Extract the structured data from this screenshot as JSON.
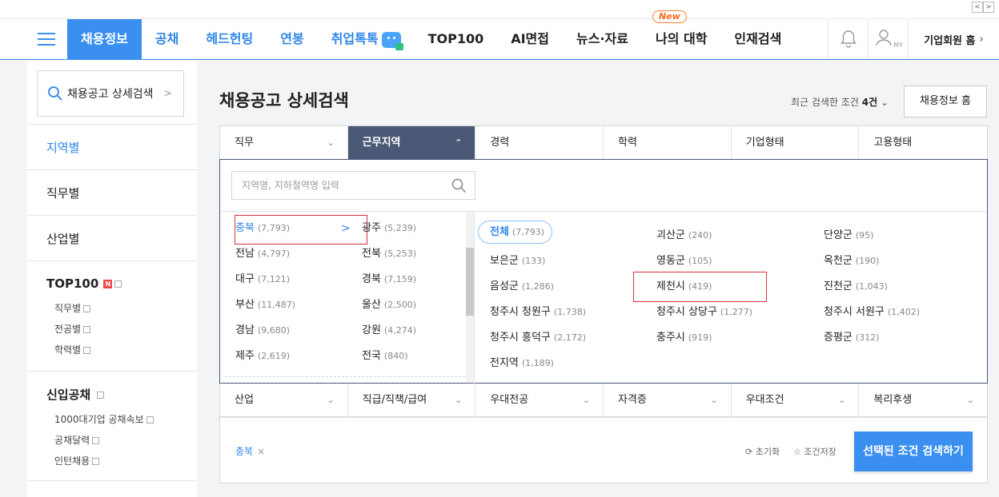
{
  "pager": {
    "prev": "<",
    "next": ">"
  },
  "nav": {
    "items": [
      {
        "label": "채용정보"
      },
      {
        "label": "공채"
      },
      {
        "label": "헤드헌팅"
      },
      {
        "label": "연봉"
      },
      {
        "label": "취업톡톡"
      },
      {
        "label": "TOP100"
      },
      {
        "label": "AI면접"
      },
      {
        "label": "뉴스·자료"
      },
      {
        "label": "나의 대학",
        "badge": "New"
      },
      {
        "label": "인재검색"
      }
    ],
    "my_label": "MY",
    "corp_label": "기업회원 홈",
    "corp_chevron": "›"
  },
  "sidebar": {
    "search_label": "채용공고 상세검색",
    "chevron": ">",
    "sections": [
      {
        "title": "지역별"
      },
      {
        "title": "직무별"
      },
      {
        "title": "산업별"
      },
      {
        "title": "TOP100",
        "badge": "N",
        "items": [
          "직무별",
          "전공별",
          "학력별"
        ]
      },
      {
        "title": "신입공채",
        "items": [
          "1000대기업 공채속보",
          "공채달력",
          "인턴채용"
        ]
      }
    ]
  },
  "main": {
    "title": "채용공고 상세검색",
    "recent_prefix": "최근 검색한 조건",
    "recent_count": "4건",
    "recent_chevron": "⌄",
    "home_button": "채용정보 홈"
  },
  "tabs": [
    {
      "label": "직무",
      "arrow": "⌄"
    },
    {
      "label": "근무지역",
      "arrow": "⌃"
    },
    {
      "label": "경력",
      "arrow": ""
    },
    {
      "label": "학력",
      "arrow": ""
    },
    {
      "label": "기업형태",
      "arrow": ""
    },
    {
      "label": "고용형태",
      "arrow": ""
    }
  ],
  "panel": {
    "search_placeholder": "지역명, 지하철역명 입력",
    "regions_left": [
      {
        "name": "충북",
        "count": "(7,793)"
      },
      {
        "name": "전남",
        "count": "(4,797)"
      },
      {
        "name": "대구",
        "count": "(7,121)"
      },
      {
        "name": "부산",
        "count": "(11,487)"
      },
      {
        "name": "경남",
        "count": "(9,680)"
      },
      {
        "name": "제주",
        "count": "(2,619)"
      }
    ],
    "regions_right": [
      {
        "name": "광주",
        "count": "(5,239)"
      },
      {
        "name": "전북",
        "count": "(5,253)"
      },
      {
        "name": "경북",
        "count": "(7,159)"
      },
      {
        "name": "울산",
        "count": "(2,500)"
      },
      {
        "name": "강원",
        "count": "(4,274)"
      },
      {
        "name": "전국",
        "count": "(840)"
      }
    ],
    "selected_chevron": ">",
    "all": {
      "name": "전체",
      "count": "(7,793)"
    },
    "districts": [
      {
        "name": "괴산군",
        "count": "(240)"
      },
      {
        "name": "단양군",
        "count": "(95)"
      },
      {
        "name": "보은군",
        "count": "(133)"
      },
      {
        "name": "영동군",
        "count": "(105)"
      },
      {
        "name": "옥천군",
        "count": "(190)"
      },
      {
        "name": "음성군",
        "count": "(1,286)"
      },
      {
        "name": "제천시",
        "count": "(419)"
      },
      {
        "name": "진천군",
        "count": "(1,043)"
      },
      {
        "name": "청주시 청원구",
        "count": "(1,738)"
      },
      {
        "name": "청주시 상당구",
        "count": "(1,277)"
      },
      {
        "name": "청주시 서원구",
        "count": "(1,402)"
      },
      {
        "name": "청주시 흥덕구",
        "count": "(2,172)"
      },
      {
        "name": "충주시",
        "count": "(919)"
      },
      {
        "name": "증평군",
        "count": "(312)"
      },
      {
        "name": "전지역",
        "count": "(1,189)"
      }
    ]
  },
  "tabs2": [
    {
      "label": "산업",
      "arrow": "⌄"
    },
    {
      "label": "직급/직책/급여",
      "arrow": "⌄"
    },
    {
      "label": "우대전공",
      "arrow": "⌄"
    },
    {
      "label": "자격증",
      "arrow": "⌄"
    },
    {
      "label": "우대조건",
      "arrow": "⌄"
    },
    {
      "label": "복리후생",
      "arrow": "⌄"
    }
  ],
  "result": {
    "chip_label": "충북",
    "chip_remove": "×",
    "reset_icon": "⟳",
    "reset_label": "초기화",
    "save_icon": "☆",
    "save_label": "조건저장",
    "search_button": "선택된 조건 검색하기"
  }
}
